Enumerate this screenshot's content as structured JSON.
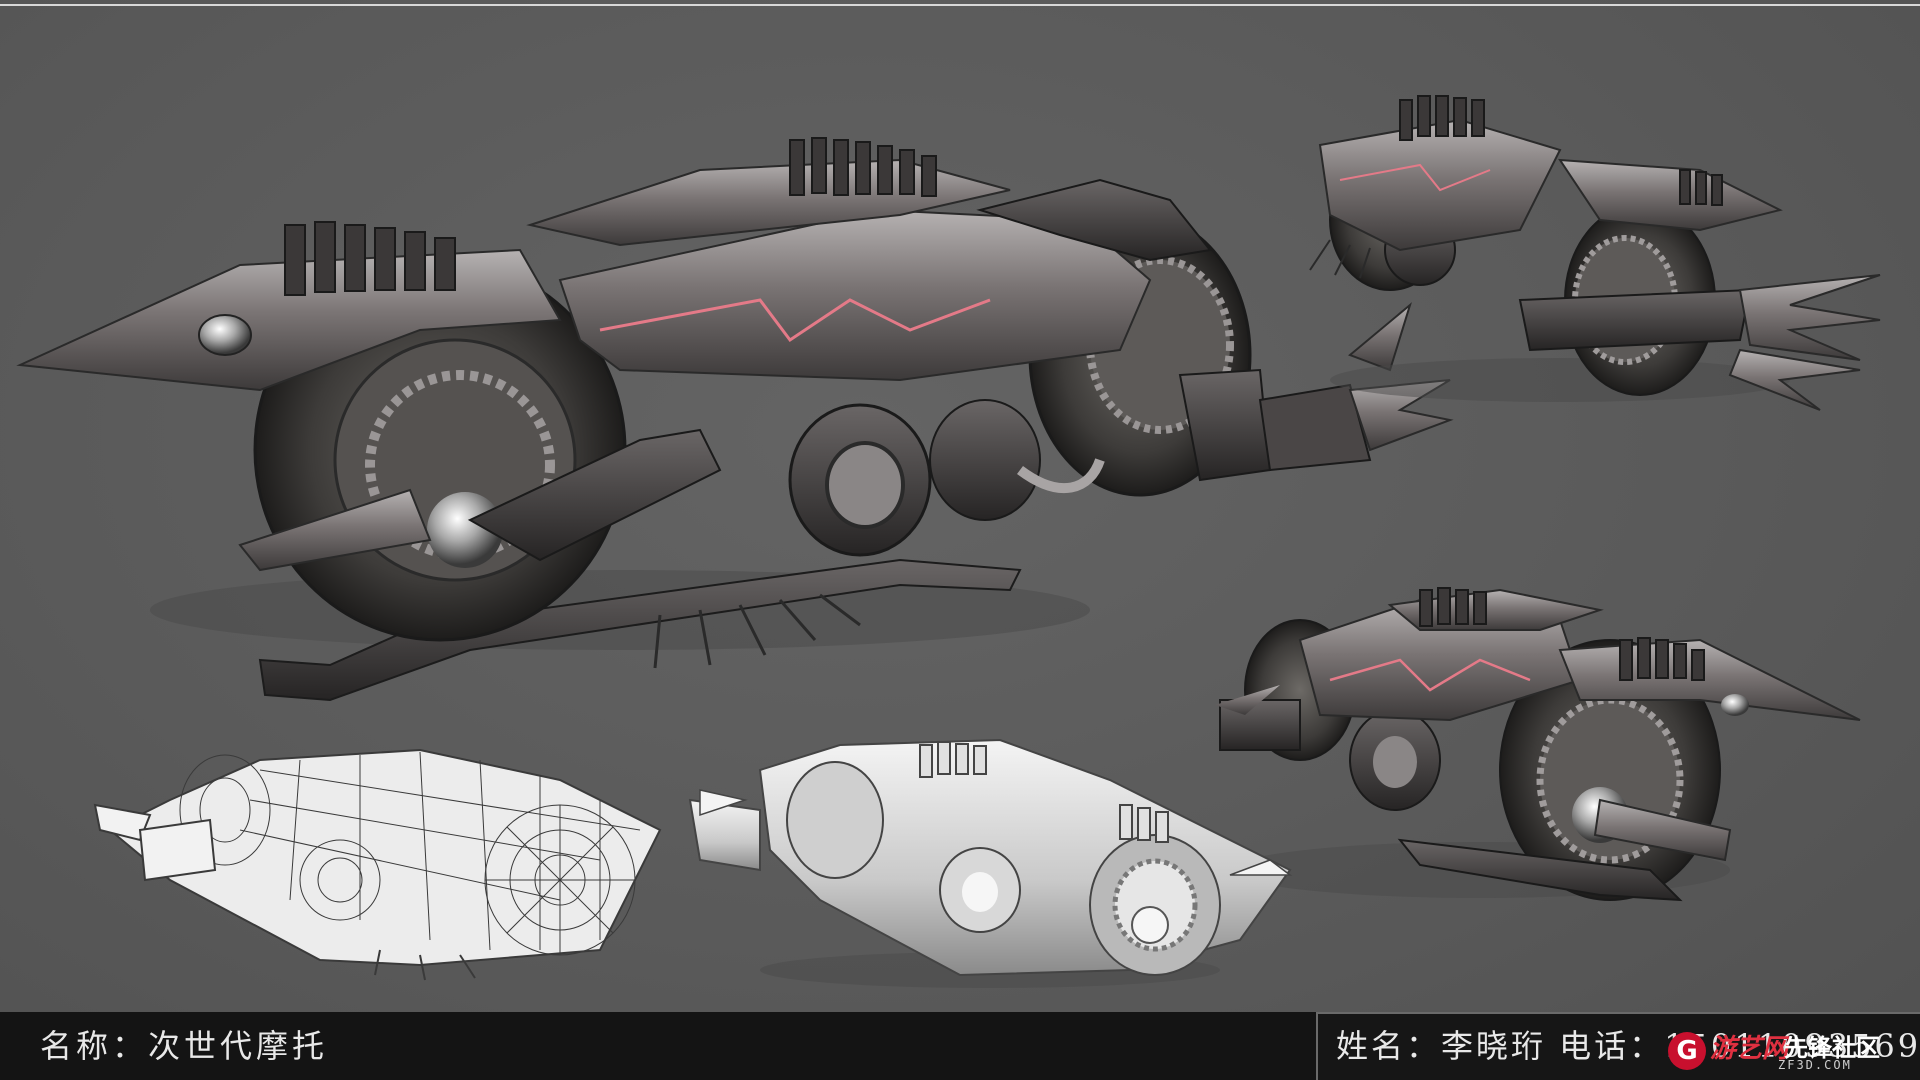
{
  "footer": {
    "name_label": "名称：次世代摩托",
    "author_label": "姓名：李晓珩 电话：15011093569"
  },
  "watermark": {
    "logo_letter": "G",
    "site_name": "游艺网",
    "community": "先锋社区",
    "url": "ZF3D.COM"
  },
  "colors": {
    "background": "#5b5b5b",
    "footer_bar": "#141414",
    "metal_dark": "#3a3a3a",
    "metal_light": "#9a9a9a",
    "accent_glow": "#d86a78",
    "watermark_red": "#c8102e"
  }
}
